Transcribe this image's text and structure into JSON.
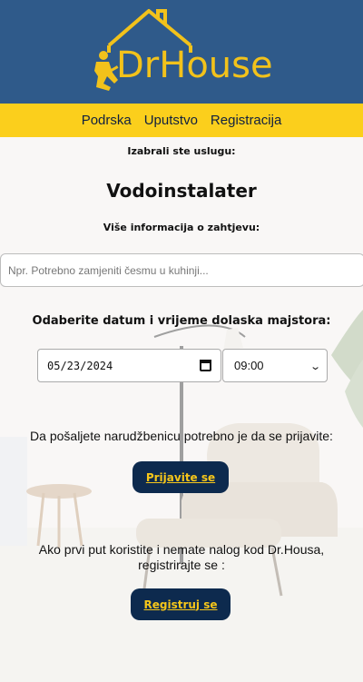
{
  "brand": {
    "name": "DrHouse",
    "colors": {
      "header": "#2f5a8a",
      "accent": "#fbcf1c",
      "button": "#0d2a4e",
      "button_text": "#f6c61a"
    }
  },
  "nav": {
    "items": [
      {
        "label": "Podrska"
      },
      {
        "label": "Uputstvo"
      },
      {
        "label": "Registracija"
      }
    ]
  },
  "form": {
    "selected_label": "Izabrali ste uslugu:",
    "service_name": "Vodoinstalater",
    "info_label": "Više informacija o zahtjevu:",
    "info_placeholder": "Npr. Potrebno zamjeniti česmu u kuhinji...",
    "info_value": "",
    "date_label": "Odaberite datum i vrijeme dolaska majstora:",
    "date_value": "05/23/2024",
    "time_value": "09:00"
  },
  "auth": {
    "login_prompt": "Da pošaljete narudžbenicu potrebno je da se prijavite:",
    "login_button": "Prijavite se",
    "register_prompt_line1": "Ako prvi put koristite i nemate nalog kod Dr.Housa,",
    "register_prompt_line2": "registrirajte se :",
    "register_button": "Registruj se"
  },
  "icons": {
    "calendar": "calendar-icon",
    "dropdown": "chevron-down-icon",
    "logo_house": "house-icon",
    "logo_worker": "plumber-icon"
  }
}
